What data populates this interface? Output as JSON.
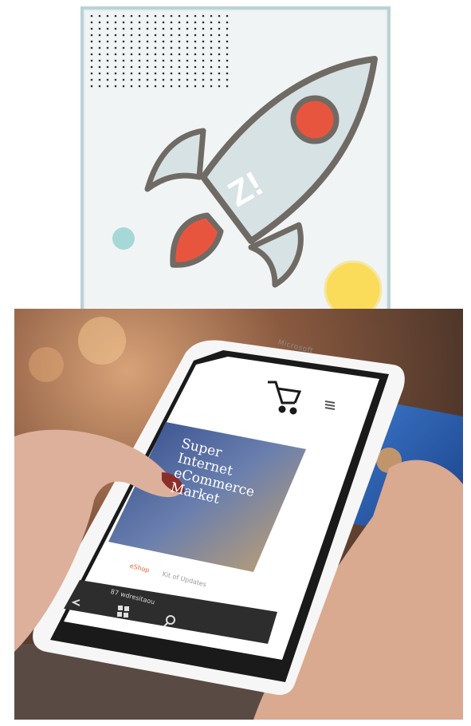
{
  "logo": {
    "monogram": "Z!",
    "colors": {
      "background": "#f1f4f5",
      "frame": "#b9d2d6",
      "rocket_body": "#d7e2e4",
      "outline": "#6f6a64",
      "window": "#e8553f",
      "flame": "#e8553f",
      "sun": "#fadb5a",
      "dot": "#a5d8d6"
    }
  },
  "photo": {
    "phone_brand": "Microsoft",
    "hero_lines": [
      "Super",
      "Internet",
      "eCommerce",
      "Market"
    ],
    "tabs": [
      "eShop",
      "Kit of Updates"
    ],
    "url_text": "87 wdresitaou",
    "icons": [
      "cart-icon",
      "hamburger-menu-icon",
      "back-icon",
      "windows-icon",
      "search-icon"
    ]
  }
}
